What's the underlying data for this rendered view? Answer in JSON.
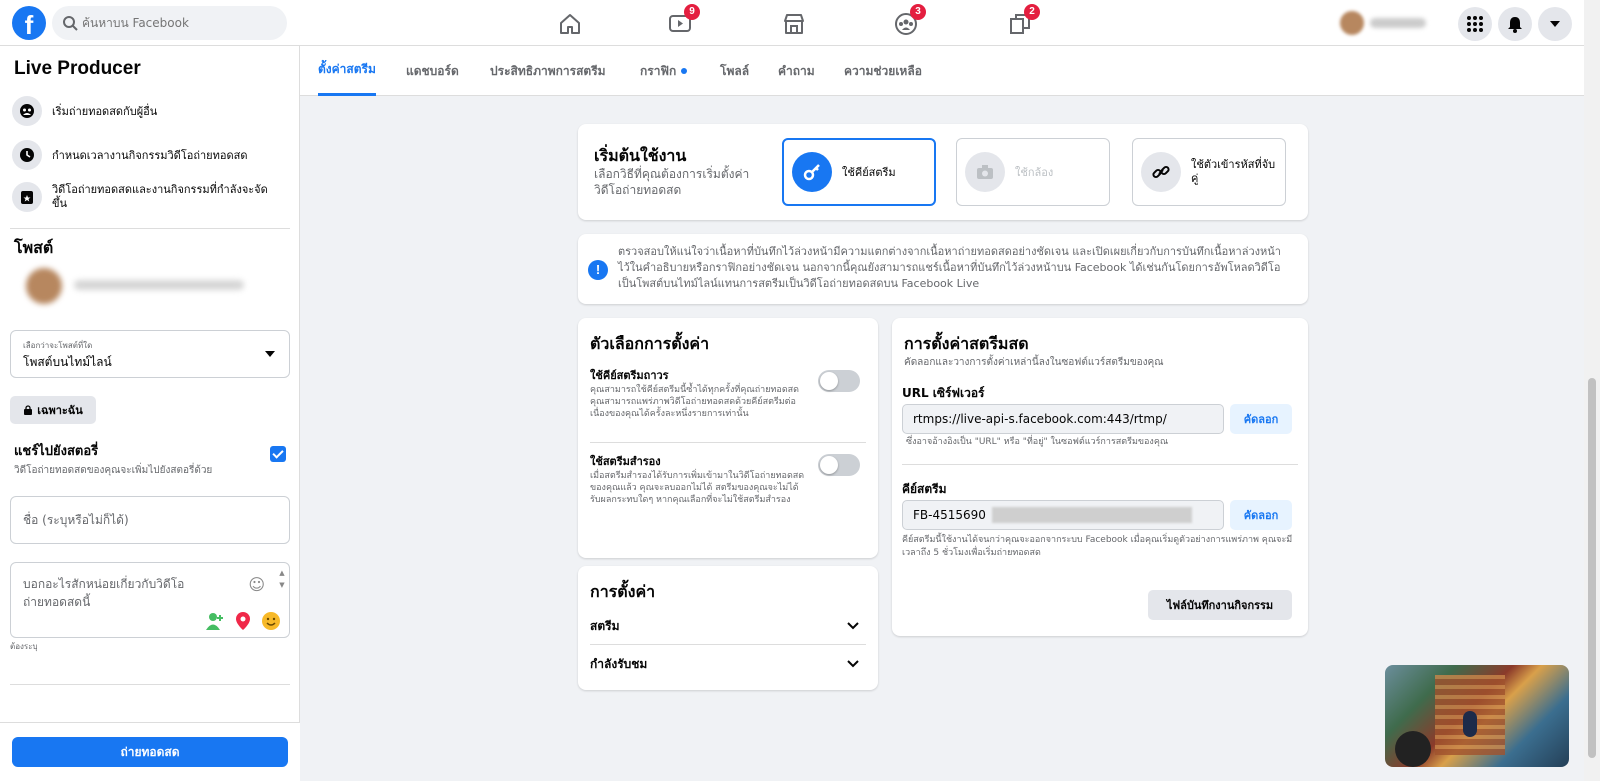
{
  "topbar": {
    "search_placeholder": "ค้นหาบน Facebook",
    "nav": [
      {
        "icon": "home-icon",
        "badge": ""
      },
      {
        "icon": "watch-icon",
        "badge": "9"
      },
      {
        "icon": "marketplace-icon",
        "badge": ""
      },
      {
        "icon": "groups-icon",
        "badge": "3"
      },
      {
        "icon": "gaming-icon",
        "badge": "2"
      }
    ]
  },
  "sidebar": {
    "title": "Live Producer",
    "items": [
      {
        "icon": "people-icon",
        "label": "เริ่มถ่ายทอดสดกับผู้อื่น"
      },
      {
        "icon": "clock-icon",
        "label": "กำหนดเวลางานกิจกรรมวิดีโอถ่ายทอดสด"
      },
      {
        "icon": "calendar-star-icon",
        "label": "วิดีโอถ่ายทอดสดและงานกิจกรรมที่กำลังจะจัดขึ้น"
      }
    ],
    "post_heading": "โพสต์",
    "post_to_label": "เลือกว่าจะโพสต์ที่ใด",
    "post_to_value": "โพสต์บนไทม์ไลน์",
    "privacy_label": "เฉพาะฉัน",
    "share_story_title": "แชร์ไปยังสตอรี่",
    "share_story_sub": "วิดีโอถ่ายทอดสดของคุณจะเพิ่มไปยังสตอรี่ด้วย",
    "title_placeholder": "ชื่อ (ระบุหรือไม่ก็ได้)",
    "desc_placeholder": "บอกอะไรสักหน่อยเกี่ยวกับวิดีโอถ่ายทอดสดนี้",
    "required_label": "ต้องระบุ",
    "go_live_label": "ถ่ายทอดสด"
  },
  "tabs": [
    {
      "label": "ตั้งค่าสตรีม",
      "active": true
    },
    {
      "label": "แดชบอร์ด",
      "active": false
    },
    {
      "label": "ประสิทธิภาพการสตรีม",
      "active": false
    },
    {
      "label": "กราฟิก",
      "active": false
    },
    {
      "label": "โพลล์",
      "active": false
    },
    {
      "label": "คำถาม",
      "active": false
    },
    {
      "label": "ความช่วยเหลือ",
      "active": false
    }
  ],
  "get_started": {
    "title": "เริ่มต้นใช้งาน",
    "subtitle": "เลือกวิธีที่คุณต้องการเริ่มตั้งค่าวิดีโอถ่ายทอดสด",
    "options": [
      {
        "icon": "key-icon",
        "label": "ใช้คีย์สตรีม",
        "selected": true
      },
      {
        "icon": "camera-icon",
        "label": "ใช้กล้อง",
        "selected": false
      },
      {
        "icon": "link-icon",
        "label": "ใช้ตัวเข้ารหัสที่จับคู่",
        "selected": false
      }
    ]
  },
  "notice": "ตรวจสอบให้แน่ใจว่าเนื้อหาที่บันทึกไว้ล่วงหน้ามีความแตกต่างจากเนื้อหาถ่ายทอดสดอย่างชัดเจน และเปิดเผยเกี่ยวกับการบันทึกเนื้อหาล่วงหน้าไว้ในคำอธิบายหรือกราฟิกอย่างชัดเจน นอกจากนี้คุณยังสามารถแชร์เนื้อหาที่บันทึกไว้ล่วงหน้าบน Facebook ได้เช่นกันโดยการอัพโหลดวิดีโอเป็นโพสต์บนไทม์ไลน์แทนการสตรีมเป็นวิดีโอถ่ายทอดสดบน Facebook Live",
  "setup_options": {
    "title": "ตัวเลือกการตั้งค่า",
    "persistent_key_title": "ใช้คีย์สตรีมถาวร",
    "persistent_key_desc": "คุณสามารถใช้คีย์สตรีมนี้ซ้ำได้ทุกครั้งที่คุณถ่ายทอดสด คุณสามารถแพร่ภาพวิดีโอถ่ายทอดสดด้วยคีย์สตรีมต่อเนื่องของคุณได้ครั้งละหนึ่งรายการเท่านั้น",
    "backup_title": "ใช้สตรีมสำรอง",
    "backup_desc": "เมื่อสตรีมสำรองได้รับการเพิ่มเข้ามาในวิดีโอถ่ายทอดสดของคุณแล้ว คุณจะลบออกไม่ได้ สตรีมของคุณจะไม่ได้รับผลกระทบใดๆ หากคุณเลือกที่จะไม่ใช้สตรีมสำรอง"
  },
  "settings": {
    "title": "การตั้งค่า",
    "rows": [
      "สตรีม",
      "กำลังรับชม"
    ]
  },
  "live_settings": {
    "title": "การตั้งค่าสตรีมสด",
    "subtitle": "คัดลอกและวางการตั้งค่าเหล่านี้ลงในซอฟต์แวร์สตรีมของคุณ",
    "server_url_label": "URL เซิร์ฟเวอร์",
    "server_url_value": "rtmps://live-api-s.facebook.com:443/rtmp/",
    "server_url_hint": "ซึ่งอาจอ้างอิงเป็น \"URL\" หรือ \"ที่อยู่\" ในซอฟต์แวร์การสตรีมของคุณ",
    "stream_key_label": "คีย์สตรีม",
    "stream_key_value": "FB-4515690",
    "stream_key_hint": "คีย์สตรีมนี้ใช้งานได้จนกว่าคุณจะออกจากระบบ Facebook เมื่อคุณเริ่มดูตัวอย่างการแพร่ภาพ คุณจะมีเวลาถึง 5 ชั่วโมงเพื่อเริ่มถ่ายทอดสด",
    "copy_label": "คัดลอก",
    "event_log_label": "ไฟล์บันทึกงานกิจกรรม"
  },
  "colors": {
    "accent": "#1877f2",
    "badge": "#e41e3f",
    "background": "#f0f2f5"
  }
}
